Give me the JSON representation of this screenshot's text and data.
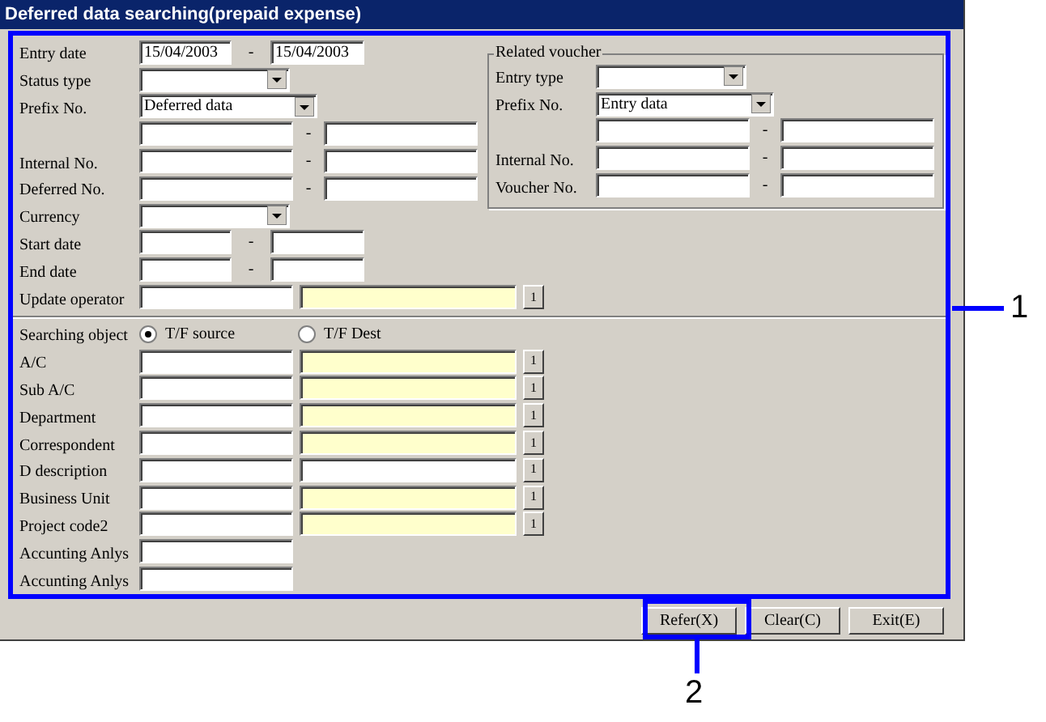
{
  "window": {
    "title": "Deferred data searching(prepaid expense)"
  },
  "main_fields": [
    {
      "kind": "dates",
      "label": "Entry date",
      "from": "15/04/2003",
      "separator": "-",
      "to": "15/04/2003"
    },
    {
      "kind": "combo",
      "label": "Status type"
    },
    {
      "kind": "prefix",
      "label": "Prefix No.",
      "value": "Deferred data"
    },
    {
      "kind": "numbers",
      "separator": "-"
    },
    {
      "kind": "numbers",
      "label": "Internal No.",
      "separator": "-"
    },
    {
      "kind": "numbers",
      "label": "Deferred No.",
      "separator": "-"
    },
    {
      "kind": "combo",
      "label": "Currency"
    },
    {
      "kind": "dates",
      "label": "Start date",
      "separator": "-"
    },
    {
      "kind": "dates",
      "label": "End date",
      "separator": "-"
    }
  ],
  "related_voucher": {
    "title": "Related voucher",
    "fields": [
      {
        "kind": "combo",
        "label": "Entry type"
      },
      {
        "kind": "prefix",
        "label": "Prefix No.",
        "value": "Entry data"
      },
      {
        "kind": "numbers",
        "separator": "-"
      },
      {
        "kind": "numbers",
        "label": "Internal No.",
        "separator": "-"
      },
      {
        "kind": "numbers",
        "label": "Voucher No.",
        "separator": "-"
      }
    ]
  },
  "operator_row": {
    "kind": "lookup",
    "label": "Update operator",
    "highlighted": true,
    "button": "1"
  },
  "searching_object": {
    "label": "Searching object",
    "options": [
      {
        "label": "T/F source",
        "selected": true
      },
      {
        "label": "T/F Dest",
        "selected": false
      }
    ]
  },
  "search_fields": [
    {
      "kind": "lookup",
      "label": "A/C",
      "highlighted": true,
      "button": "1"
    },
    {
      "kind": "lookup",
      "label": "Sub A/C",
      "highlighted": true,
      "button": "1"
    },
    {
      "kind": "lookup",
      "label": "Department",
      "highlighted": true,
      "button": "1"
    },
    {
      "kind": "lookup",
      "label": "Correspondent",
      "highlighted": true,
      "button": "1"
    },
    {
      "kind": "lookup",
      "label": "D description",
      "highlighted": false,
      "button": "1"
    },
    {
      "kind": "lookup",
      "label": "Business Unit",
      "highlighted": true,
      "button": "1"
    },
    {
      "kind": "lookup",
      "label": "Project code2",
      "highlighted": true,
      "button": "1"
    },
    {
      "kind": "text",
      "label": "Accunting Anlys"
    },
    {
      "kind": "text",
      "label": "Accunting Anlys"
    }
  ],
  "buttons": [
    {
      "label": "Refer(X)"
    },
    {
      "label": "Clear(C)"
    },
    {
      "label": "Exit(E)"
    }
  ],
  "callouts": [
    {
      "label": "1"
    },
    {
      "label": "2"
    }
  ]
}
